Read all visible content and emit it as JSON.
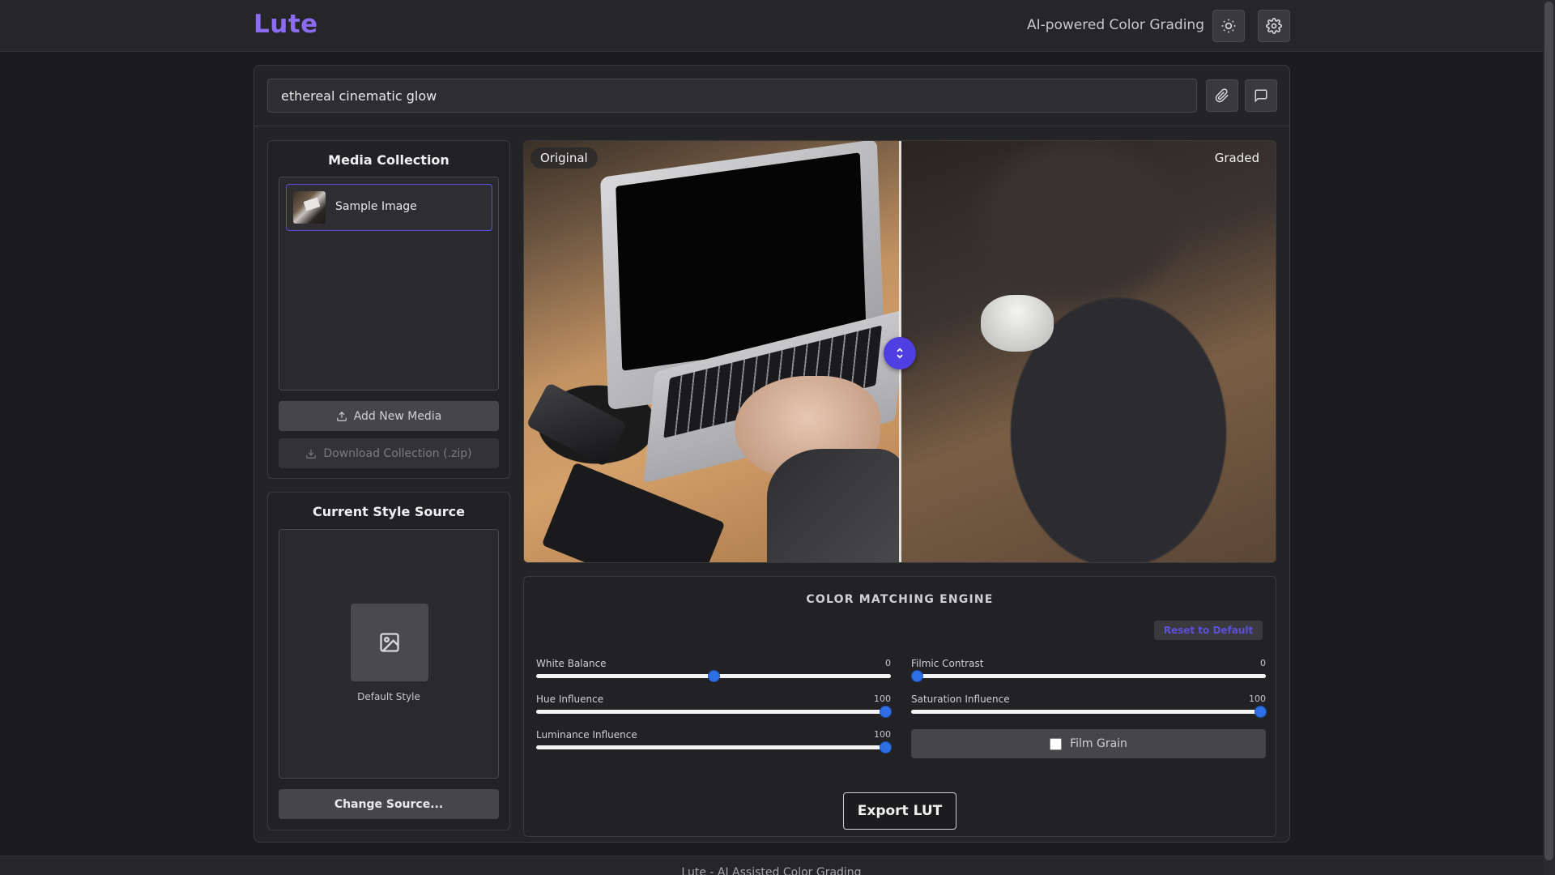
{
  "header": {
    "logo": "Lute",
    "tagline": "AI-powered Color Grading",
    "theme_icon": "sun-icon",
    "settings_icon": "gear-icon"
  },
  "prompt": {
    "value": "ethereal cinematic glow",
    "attach_icon": "paperclip-icon",
    "chat_icon": "chat-bubble-icon"
  },
  "media_collection": {
    "title": "Media Collection",
    "items": [
      {
        "label": "Sample Image"
      }
    ],
    "add_label": "Add New Media",
    "download_label": "Download Collection (.zip)"
  },
  "style_source": {
    "title": "Current Style Source",
    "default_label": "Default Style",
    "change_label": "Change Source..."
  },
  "viewer": {
    "original_label": "Original",
    "graded_label": "Graded",
    "split_position": 0.5
  },
  "engine": {
    "title": "COLOR MATCHING ENGINE",
    "reset_label": "Reset to Default",
    "sliders": {
      "white_balance": {
        "label": "White Balance",
        "value": "0",
        "fraction": 0.5
      },
      "filmic_contrast": {
        "label": "Filmic Contrast",
        "value": "0",
        "fraction": 0.0
      },
      "hue_influence": {
        "label": "Hue Influence",
        "value": "100",
        "fraction": 1.0
      },
      "saturation_influence": {
        "label": "Saturation Influence",
        "value": "100",
        "fraction": 1.0
      },
      "luminance_influence": {
        "label": "Luminance Influence",
        "value": "100",
        "fraction": 1.0
      }
    },
    "film_grain_label": "Film Grain",
    "film_grain_checked": false
  },
  "export_label": "Export LUT",
  "footer": {
    "text": "Lute - AI Assisted Color Grading"
  },
  "colors": {
    "accent": "#5b4ee0",
    "logo": "#8b6cf0",
    "slider_thumb": "#2f6fe6",
    "background": "#1c1c1e"
  }
}
